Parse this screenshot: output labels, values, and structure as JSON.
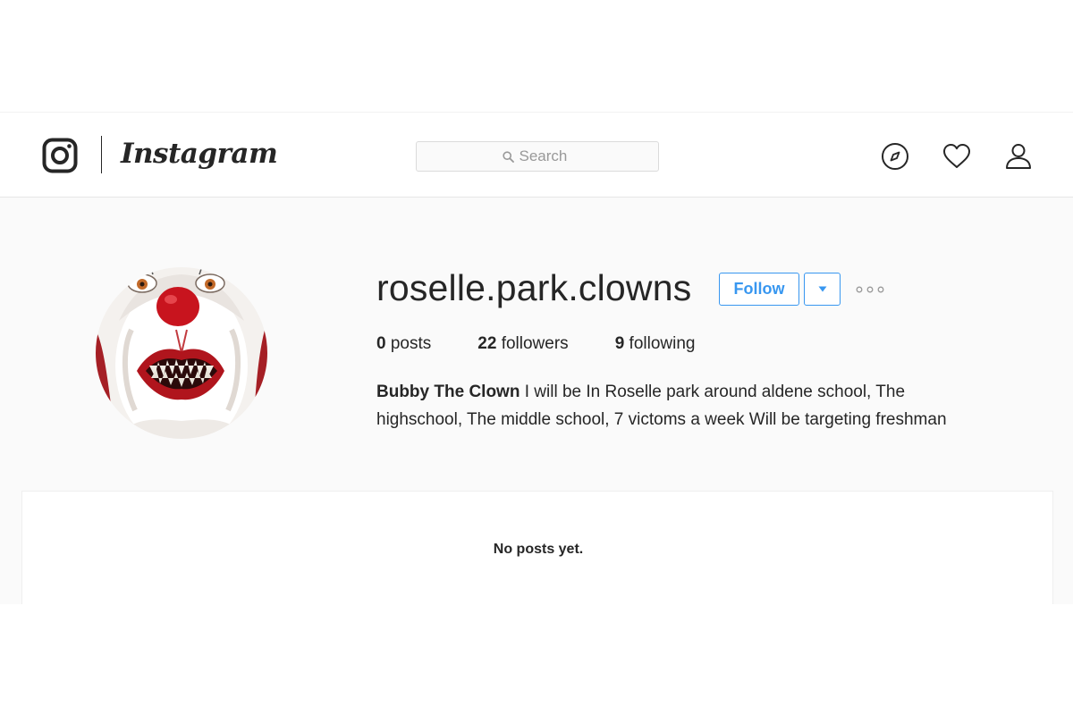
{
  "header": {
    "wordmark": "Instagram",
    "search_placeholder": "Search",
    "icons": {
      "logo": "instagram-camera-icon",
      "explore": "compass-icon",
      "activity": "heart-icon",
      "profile": "person-icon",
      "search": "magnifier-icon"
    }
  },
  "profile": {
    "username": "roselle.park.clowns",
    "follow_label": "Follow",
    "dropdown_icon": "caret-down-icon",
    "more_icon": "ellipsis-icon",
    "avatar": "clown-face-avatar",
    "stats": {
      "posts_count": "0",
      "posts_label": "posts",
      "followers_count": "22",
      "followers_label": "followers",
      "following_count": "9",
      "following_label": "following"
    },
    "full_name": "Bubby The Clown",
    "bio_line1": "I will be In Roselle park around aldene school, The",
    "bio_line2": "highschool, The middle school, 7 victoms a week Will be targeting freshman"
  },
  "posts": {
    "empty_message": "No posts yet."
  },
  "colors": {
    "accent": "#3897f0",
    "text": "#262626",
    "muted": "#999999",
    "page_background": "#fafafa",
    "border": "#dbdbdb"
  }
}
